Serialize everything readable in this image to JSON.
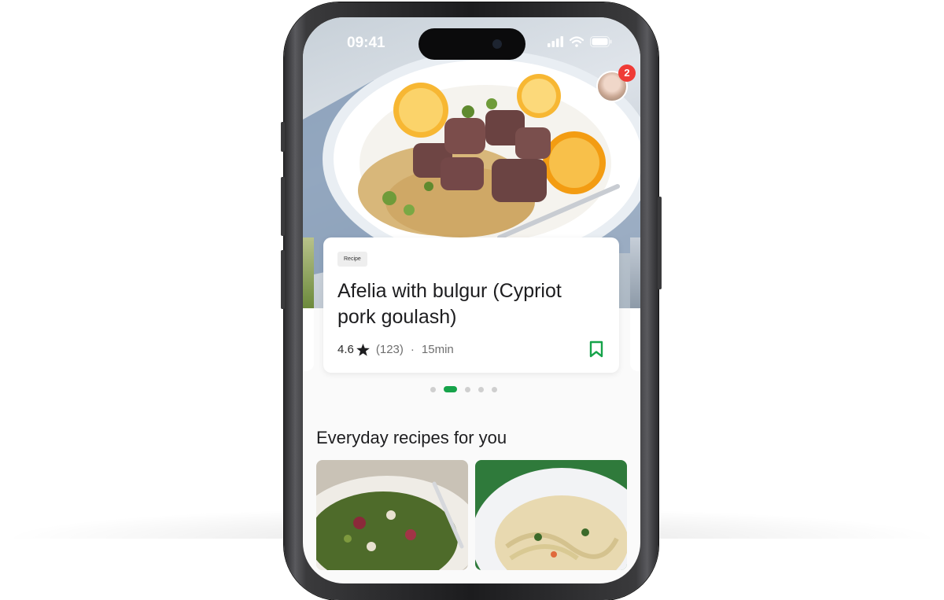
{
  "status_bar": {
    "time": "09:41"
  },
  "notifications": {
    "count": "2"
  },
  "featured": {
    "tag": "Recipe",
    "title": "Afelia with bulgur (Cypriot pork goulash)",
    "rating": "4.6",
    "reviews": "(123)",
    "separator": "·",
    "duration": "15min"
  },
  "carousel": {
    "total": 5,
    "active_index": 1
  },
  "section": {
    "title": "Everyday recipes for you"
  },
  "colors": {
    "accent": "#16a34a",
    "badge": "#ef3b36"
  },
  "icons": [
    "wifi-icon",
    "signal-icon",
    "battery-icon",
    "star-icon",
    "bookmark-icon"
  ]
}
